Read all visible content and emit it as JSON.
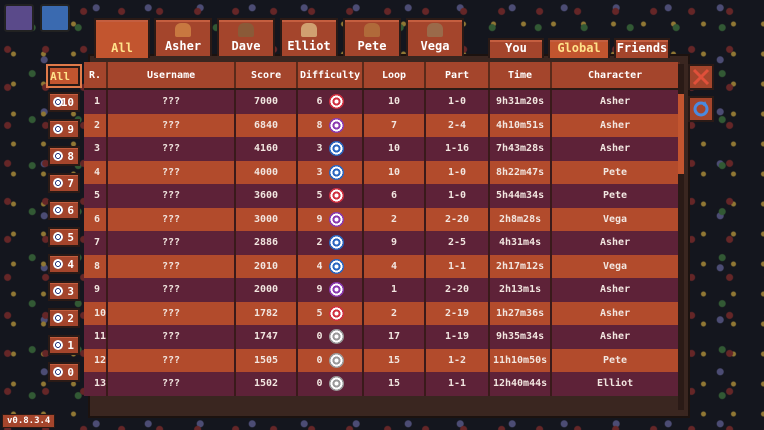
{
  "tabs": {
    "all_label": "All",
    "characters": [
      {
        "label": "Asher",
        "color": "#c87840"
      },
      {
        "label": "Dave",
        "color": "#8a5a38"
      },
      {
        "label": "Elliot",
        "color": "#d0a070"
      },
      {
        "label": "Pete",
        "color": "#b06a3a"
      },
      {
        "label": "Vega",
        "color": "#9a6a4a"
      }
    ],
    "scope": [
      {
        "label": "You",
        "active": false
      },
      {
        "label": "Global",
        "active": true
      },
      {
        "label": "Friends",
        "active": false
      }
    ]
  },
  "side_filter": {
    "all_label": "All",
    "levels": [
      "10",
      "9",
      "8",
      "7",
      "6",
      "5",
      "4",
      "3",
      "2",
      "1",
      "0"
    ]
  },
  "columns": [
    "R.",
    "Username",
    "Score",
    "Difficulty",
    "Loop",
    "Part",
    "Time",
    "Character"
  ],
  "rows": [
    {
      "rank": "1",
      "user": "???",
      "score": "7000",
      "diff": "6",
      "loop": "10",
      "part": "1-0",
      "time": "9h31m20s",
      "char": "Asher",
      "icon": "#d03040"
    },
    {
      "rank": "2",
      "user": "???",
      "score": "6840",
      "diff": "8",
      "loop": "7",
      "part": "2-4",
      "time": "4h10m51s",
      "char": "Asher",
      "icon": "#8a3ab0"
    },
    {
      "rank": "3",
      "user": "???",
      "score": "4160",
      "diff": "3",
      "loop": "10",
      "part": "1-16",
      "time": "7h43m28s",
      "char": "Asher",
      "icon": "#2a66c0"
    },
    {
      "rank": "4",
      "user": "???",
      "score": "4000",
      "diff": "3",
      "loop": "10",
      "part": "1-0",
      "time": "8h22m47s",
      "char": "Pete",
      "icon": "#2a66c0"
    },
    {
      "rank": "5",
      "user": "???",
      "score": "3600",
      "diff": "5",
      "loop": "6",
      "part": "1-0",
      "time": "5h44m34s",
      "char": "Pete",
      "icon": "#d03040"
    },
    {
      "rank": "6",
      "user": "???",
      "score": "3000",
      "diff": "9",
      "loop": "2",
      "part": "2-20",
      "time": "2h8m28s",
      "char": "Vega",
      "icon": "#8a3ab0"
    },
    {
      "rank": "7",
      "user": "???",
      "score": "2886",
      "diff": "2",
      "loop": "9",
      "part": "2-5",
      "time": "4h31m4s",
      "char": "Asher",
      "icon": "#2a66c0"
    },
    {
      "rank": "8",
      "user": "???",
      "score": "2010",
      "diff": "4",
      "loop": "4",
      "part": "1-1",
      "time": "2h17m12s",
      "char": "Vega",
      "icon": "#2a66c0"
    },
    {
      "rank": "9",
      "user": "???",
      "score": "2000",
      "diff": "9",
      "loop": "1",
      "part": "2-20",
      "time": "2h13m1s",
      "char": "Asher",
      "icon": "#8a3ab0"
    },
    {
      "rank": "10",
      "user": "???",
      "score": "1782",
      "diff": "5",
      "loop": "2",
      "part": "2-19",
      "time": "1h27m36s",
      "char": "Asher",
      "icon": "#d03040"
    },
    {
      "rank": "11",
      "user": "???",
      "score": "1747",
      "diff": "0",
      "loop": "17",
      "part": "1-19",
      "time": "9h35m34s",
      "char": "Asher",
      "icon": "#999999"
    },
    {
      "rank": "12",
      "user": "???",
      "score": "1505",
      "diff": "0",
      "loop": "15",
      "part": "1-2",
      "time": "11h10m50s",
      "char": "Pete",
      "icon": "#999999"
    },
    {
      "rank": "13",
      "user": "???",
      "score": "1502",
      "diff": "0",
      "loop": "15",
      "part": "1-1",
      "time": "12h40m44s",
      "char": "Elliot",
      "icon": "#999999"
    }
  ],
  "version": "v0.8.3.4"
}
